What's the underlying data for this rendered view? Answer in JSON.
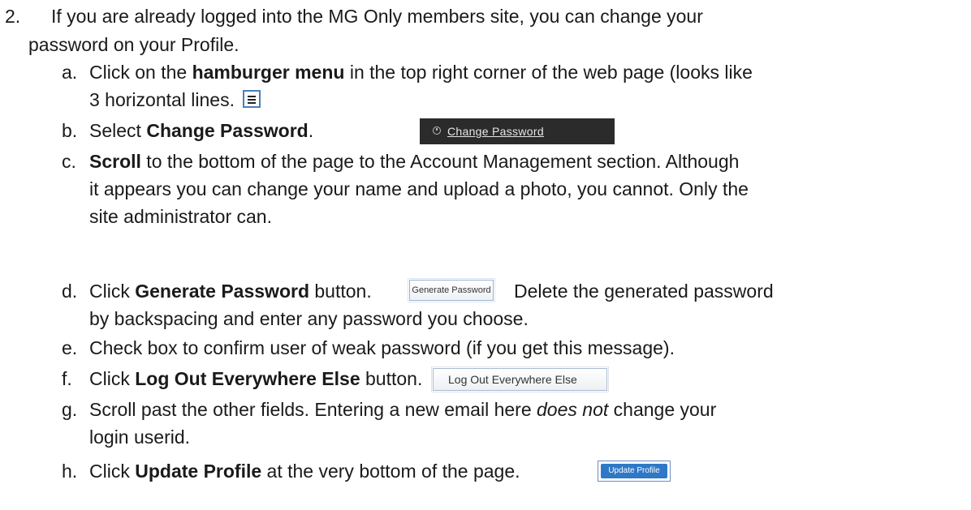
{
  "item2": {
    "number": "2.",
    "line1": "If you are already logged into the MG Only members site, you can change your",
    "line2": "password on your Profile."
  },
  "steps": {
    "a": {
      "letter": "a.",
      "pre": "Click on the ",
      "bold": "hamburger menu",
      "post": " in the top right corner of the web page (looks like",
      "line2": "3 horizontal lines.",
      "icon": "hamburger-icon"
    },
    "b": {
      "letter": "b.",
      "pre": "Select ",
      "bold": "Change Password",
      "post": ".",
      "button_label": "Change Password",
      "button_icon": "clock-icon"
    },
    "c": {
      "letter": "c.",
      "bold": "Scroll",
      "post": " to the bottom of the page to the Account Management section.  Although",
      "line2": "it appears you can change your name and upload a photo, you cannot.  Only the",
      "line3": "site administrator can."
    },
    "d": {
      "letter": "d.",
      "pre": "Click ",
      "bold": "Generate Password",
      "post": " button.",
      "button_label": "Generate Password",
      "after": "Delete the generated password",
      "line2": "by backspacing and enter any password you choose."
    },
    "e": {
      "letter": "e.",
      "text": "Check box to confirm user of weak password (if you get this message)."
    },
    "f": {
      "letter": "f.",
      "pre": "Click ",
      "bold": "Log Out Everywhere Else",
      "post": " button.",
      "button_label": "Log Out Everywhere Else"
    },
    "g": {
      "letter": "g.",
      "pre": "Scroll past the other fields.   Entering a new email here ",
      "italic": "does not",
      "post": " change your",
      "line2": "login userid."
    },
    "h": {
      "letter": "h.",
      "pre": "Click ",
      "bold": "Update Profile",
      "post": " at the very bottom of the page.",
      "button_label": "Update Profile"
    }
  }
}
